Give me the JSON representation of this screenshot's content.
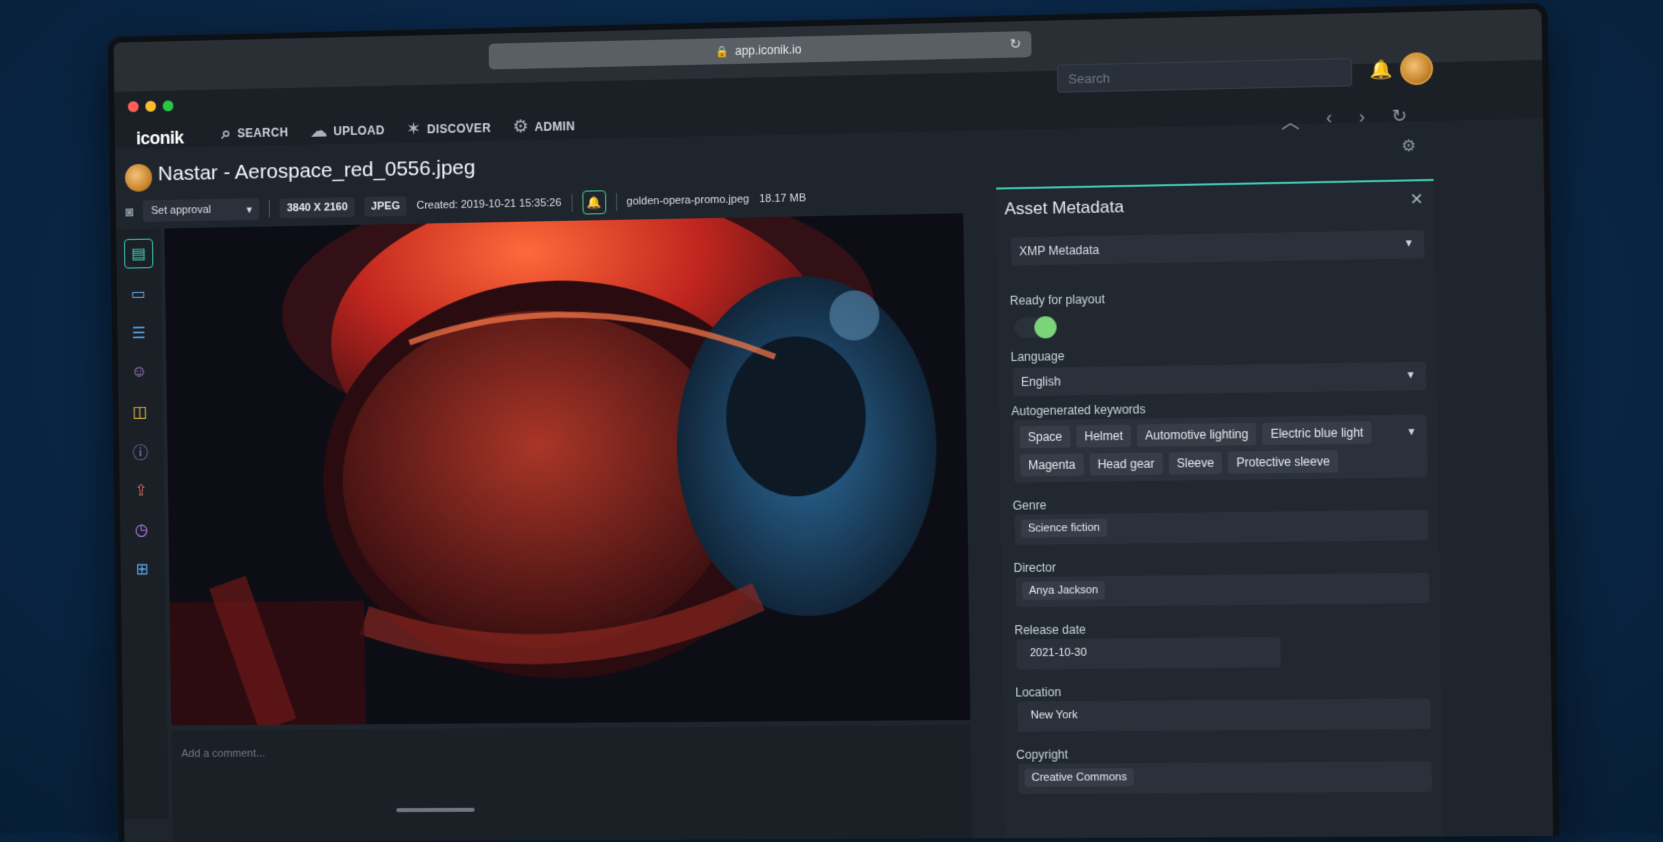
{
  "browser": {
    "url": "app.iconik.io"
  },
  "app": {
    "logo": "iconik",
    "nav": [
      {
        "label": "SEARCH",
        "icon": "search-icon"
      },
      {
        "label": "UPLOAD",
        "icon": "cloud-upload-icon"
      },
      {
        "label": "DISCOVER",
        "icon": "satellite-icon"
      },
      {
        "label": "ADMIN",
        "icon": "gear-icon"
      }
    ],
    "search_placeholder": "Search"
  },
  "asset": {
    "title": "Nastar - Aerospace_red_0556.jpeg",
    "approval": "Set approval",
    "resolution": "3840 X 2160",
    "format": "JPEG",
    "created": "Created: 2019-10-21 15:35:26",
    "linked_file": "golden-opera-promo.jpeg",
    "size": "18.17 MB"
  },
  "comment_placeholder": "Add a comment...",
  "panel": {
    "title": "Asset Metadata",
    "view": "XMP Metadata",
    "ready_label": "Ready for playout",
    "ready_value": true,
    "language_label": "Language",
    "language_value": "English",
    "keywords_label": "Autogenerated keywords",
    "keywords_row1": [
      "Space",
      "Helmet",
      "Automotive lighting",
      "Electric blue light"
    ],
    "keywords_row2": [
      "Magenta",
      "Head gear",
      "Sleeve",
      "Protective sleeve"
    ],
    "genre_label": "Genre",
    "genre_value": "Science fiction",
    "director_label": "Director",
    "director_value": "Anya Jackson",
    "release_label": "Release date",
    "release_value": "2021-10-30",
    "location_label": "Location",
    "location_value": "New York",
    "copyright_label": "Copyright",
    "copyright_value": "Creative Commons"
  },
  "colors": {
    "accent": "#3ec6b0",
    "toggle_on": "#7bd37a"
  }
}
